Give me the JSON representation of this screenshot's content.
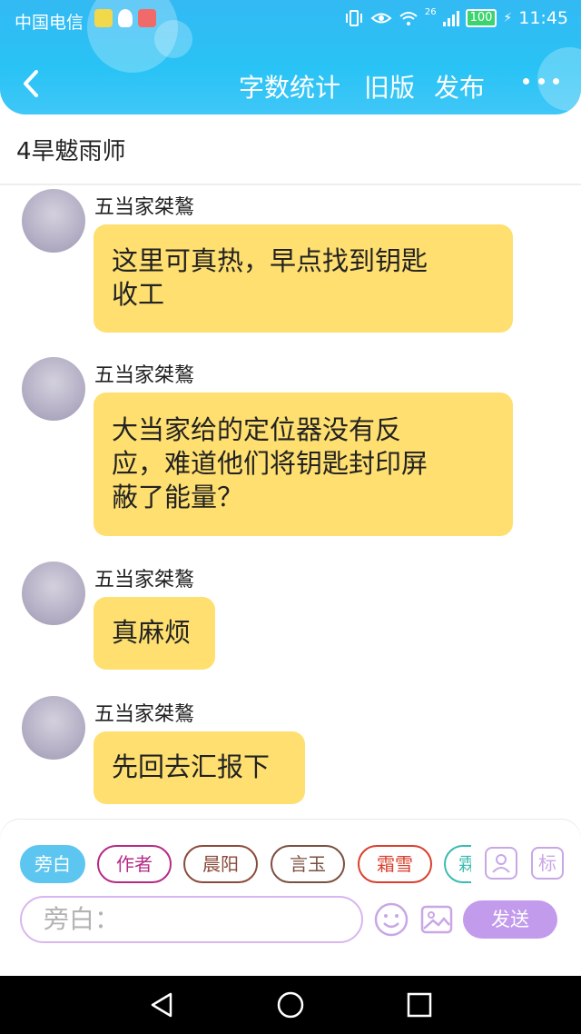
{
  "status_bar": {
    "carrier": "中国电信",
    "network": "26",
    "battery": "100",
    "time": "11:45"
  },
  "nav": {
    "back_icon": "chevron-left-icon",
    "actions": [
      "字数统计",
      "旧版",
      "发布"
    ],
    "more_icon": "more-dots-icon"
  },
  "chapter_title": "4旱魃雨师",
  "messages": [
    {
      "sender": "五当家桀鷔",
      "lines": [
        "这里可真热，早点找到钥匙",
        "收工"
      ]
    },
    {
      "sender": "五当家桀鷔",
      "lines": [
        "大当家给的定位器没有反",
        "应，难道他们将钥匙封印屏",
        "蔽了能量？"
      ]
    },
    {
      "sender": "五当家桀鷔",
      "lines": [
        "真麻烦"
      ]
    },
    {
      "sender": "五当家桀鷔",
      "lines": [
        "先回去汇报下"
      ]
    }
  ],
  "roles": [
    {
      "label": "旁白",
      "color": "#35b8ee",
      "selected": true
    },
    {
      "label": "作者",
      "color": "#b52a86",
      "selected": false
    },
    {
      "label": "晨阳",
      "color": "#8a4a3a",
      "selected": false
    },
    {
      "label": "言玉",
      "color": "#7a5040",
      "selected": false
    },
    {
      "label": "霜雪",
      "color": "#d9402e",
      "selected": false
    },
    {
      "label": "霖",
      "color": "#3bbbb0",
      "selected": false
    }
  ],
  "tools": {
    "character_icon": "character-icon",
    "mark_label": "标"
  },
  "composer": {
    "placeholder": "旁白：",
    "emoji_icon": "smiley-icon",
    "image_icon": "image-icon",
    "send_label": "发送"
  },
  "colors": {
    "header": "#33b9f3",
    "bubble": "#fedf70",
    "accent": "#c39bec"
  }
}
